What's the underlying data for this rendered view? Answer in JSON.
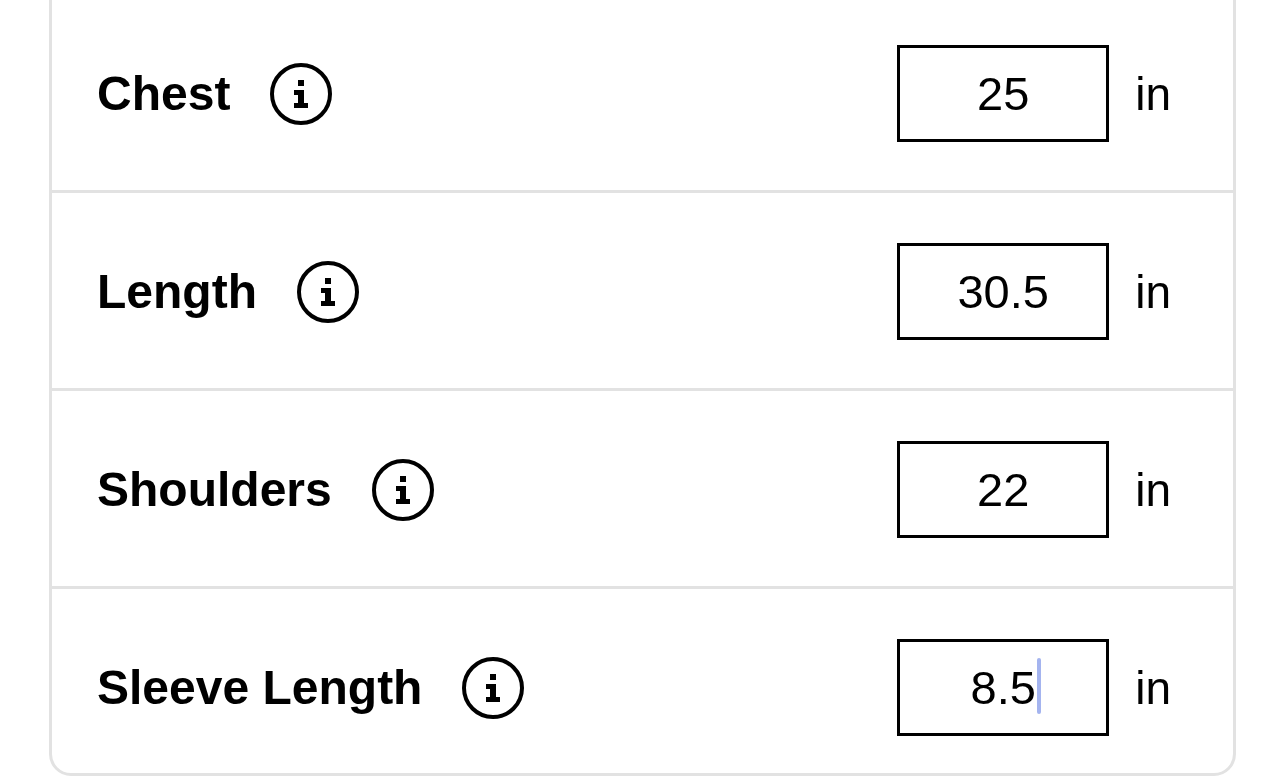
{
  "rows": [
    {
      "label": "Chest",
      "value": "25",
      "unit": "in",
      "focused": false
    },
    {
      "label": "Length",
      "value": "30.5",
      "unit": "in",
      "focused": false
    },
    {
      "label": "Shoulders",
      "value": "22",
      "unit": "in",
      "focused": false
    },
    {
      "label": "Sleeve Length",
      "value": "8.5",
      "unit": "in",
      "focused": true
    }
  ]
}
